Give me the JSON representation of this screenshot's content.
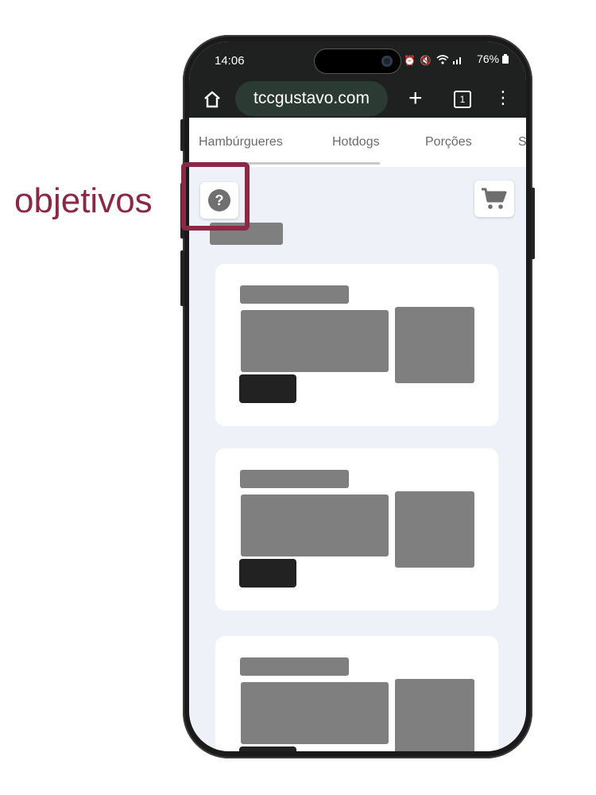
{
  "annotation": {
    "label": "objetivos",
    "color": "#8a2846"
  },
  "status_bar": {
    "time": "14:06",
    "icons": [
      "alarm-icon",
      "mute-icon",
      "wifi-icon",
      "volte-icon",
      "signal-icon"
    ],
    "battery": "76%"
  },
  "browser": {
    "url": "tccgustavo.com",
    "tab_count": "1",
    "buttons": [
      "home-icon",
      "new-tab-plus-icon",
      "tab-switcher-icon",
      "menu-more-icon"
    ]
  },
  "categories": {
    "items": [
      "Hambúrgueres",
      "Hotdogs",
      "Porções",
      "S"
    ],
    "active": "Hambúrgueres"
  },
  "toolbar": {
    "help_symbol": "?",
    "help_icon": "help-question-icon",
    "cart_icon": "cart-icon"
  },
  "colors": {
    "placeholder": "#7f7f7f",
    "button_placeholder": "#222222",
    "page_bg": "#eef2f8",
    "browser_bar": "#1e211f"
  }
}
